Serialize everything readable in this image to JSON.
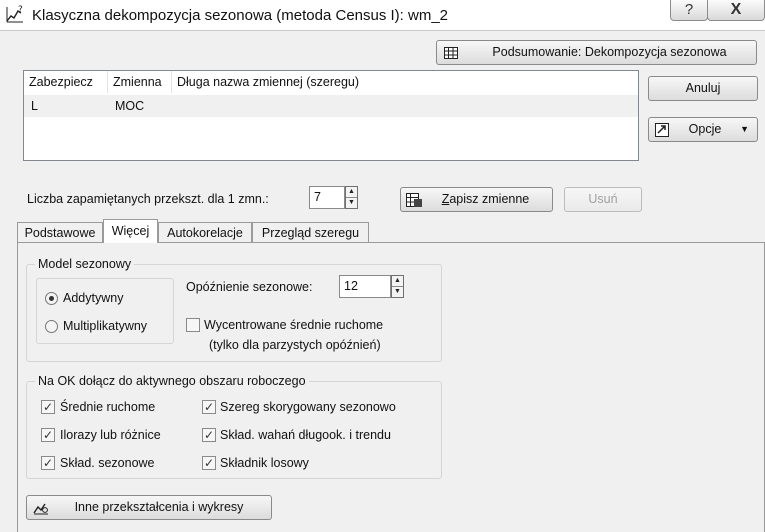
{
  "window": {
    "title": "Klasyczna dekompozycja sezonowa (metoda Census I): wm_2",
    "help_label": "?",
    "close_label": "X"
  },
  "buttons": {
    "summary": "Podsumowanie: Dekompozycja sezonowa",
    "cancel": "Anuluj",
    "options": "Opcje",
    "save_vars": "Zapisz zmienne",
    "delete": "Usuń",
    "other_transforms": "Inne przekształcenia i wykresy"
  },
  "varlist": {
    "headers": [
      "Zabezpiecz",
      "Zmienna",
      "Długa nazwa zmiennej (szeregu)"
    ],
    "rows": [
      {
        "lock": "L",
        "var": "MOC",
        "long_name": ""
      }
    ]
  },
  "remembered": {
    "label": "Liczba zapamiętanych przekszt. dla 1 zmn.:",
    "value": "7"
  },
  "tabs": [
    "Podstawowe",
    "Więcej",
    "Autokorelacje",
    "Przegląd szeregu"
  ],
  "active_tab": "Więcej",
  "seasonal_model": {
    "group_label": "Model sezonowy",
    "additive": "Addytywny",
    "multiplicative": "Multiplikatywny",
    "selected": "Addytywny"
  },
  "lag": {
    "label": "Opóźnienie sezonowe:",
    "value": "12"
  },
  "centered": {
    "label": "Wycentrowane średnie ruchome",
    "note": "(tylko dla parzystych opóźnień)",
    "checked": false
  },
  "on_ok": {
    "group_label": "Na OK dołącz do aktywnego obszaru roboczego",
    "items": [
      {
        "label": "Średnie ruchome",
        "checked": true
      },
      {
        "label": "Szereg skorygowany sezonowo",
        "checked": true
      },
      {
        "label": "Ilorazy lub różnice",
        "checked": true
      },
      {
        "label": "Skład. wahań długook. i trendu",
        "checked": true
      },
      {
        "label": "Skład. sezonowe",
        "checked": true
      },
      {
        "label": "Składnik losowy",
        "checked": true
      }
    ]
  },
  "icons": {
    "app": "chart-help-icon",
    "summary": "table-icon",
    "options": "options-icon",
    "save": "save-vars-icon",
    "other": "transform-icon"
  }
}
